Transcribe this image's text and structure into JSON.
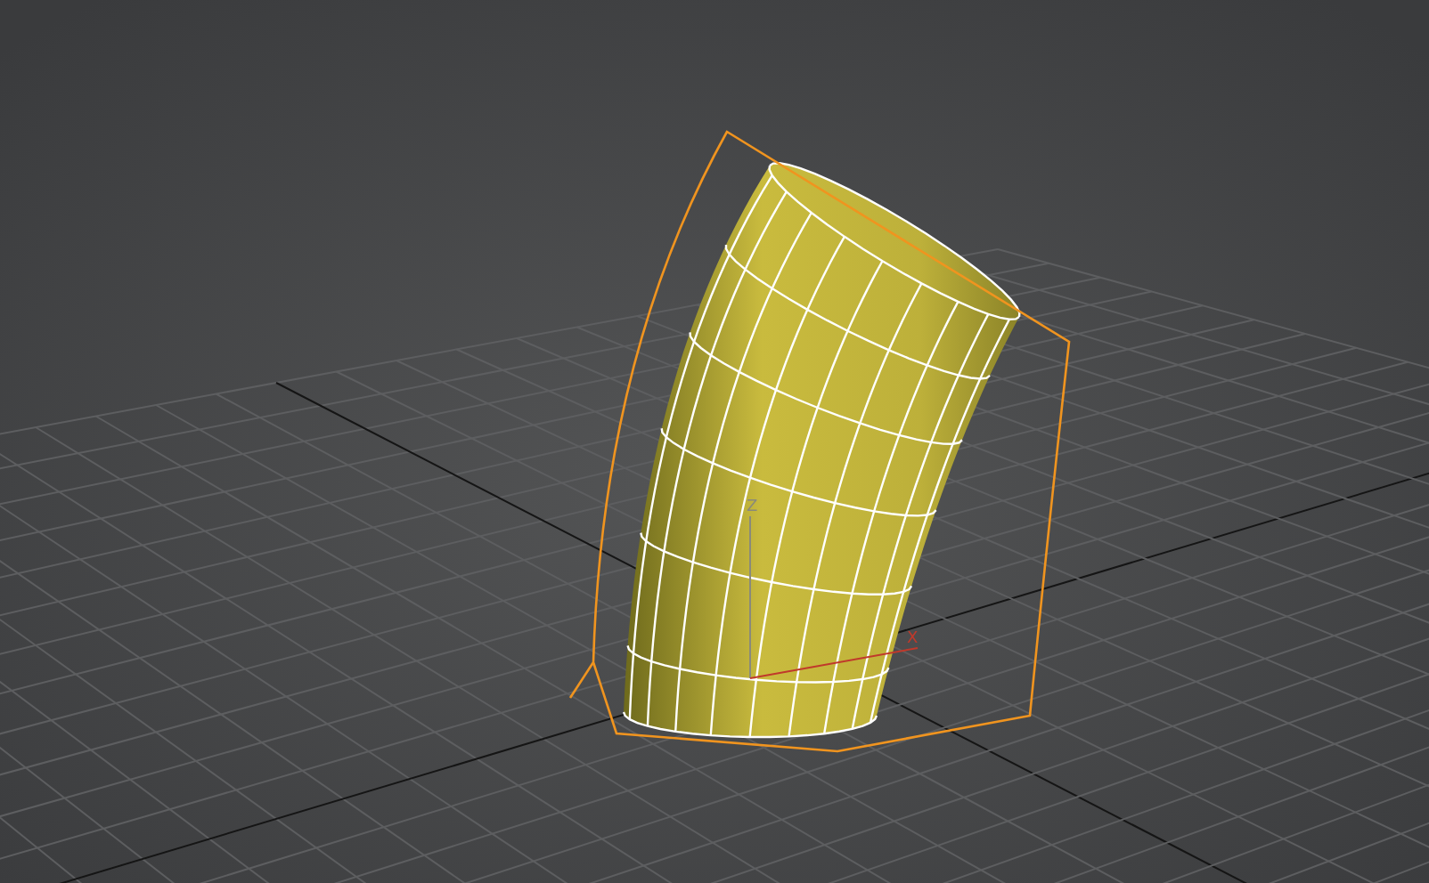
{
  "viewport": {
    "axes": [
      {
        "label": "Z",
        "color": "#8a8a7a"
      },
      {
        "label": "X",
        "color": "#c0392b"
      }
    ]
  }
}
